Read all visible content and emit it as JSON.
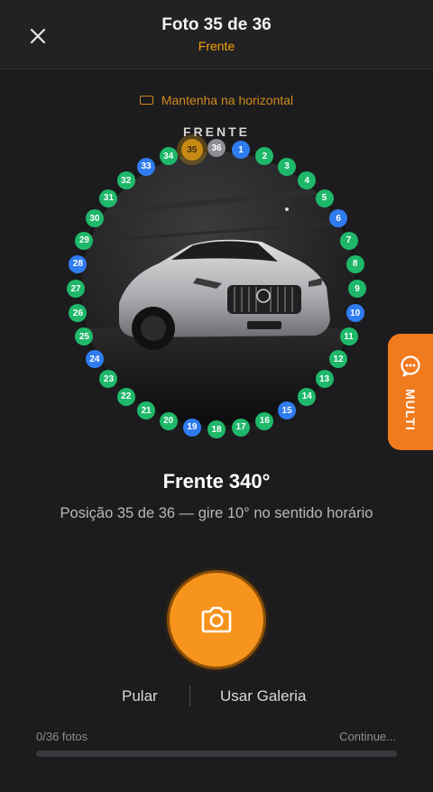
{
  "header": {
    "title": "Foto 35 de 36",
    "subtitle": "Frente"
  },
  "hint": {
    "text": "Mantenha na horizontal"
  },
  "view_label": "FRENTE",
  "positions": [
    {
      "label": "1",
      "status": "blue"
    },
    {
      "label": "2",
      "status": "green"
    },
    {
      "label": "3",
      "status": "green"
    },
    {
      "label": "4",
      "status": "green"
    },
    {
      "label": "5",
      "status": "green"
    },
    {
      "label": "6",
      "status": "blue"
    },
    {
      "label": "7",
      "status": "green"
    },
    {
      "label": "8",
      "status": "green"
    },
    {
      "label": "9",
      "status": "green"
    },
    {
      "label": "10",
      "status": "blue"
    },
    {
      "label": "11",
      "status": "green"
    },
    {
      "label": "12",
      "status": "green"
    },
    {
      "label": "13",
      "status": "green"
    },
    {
      "label": "14",
      "status": "green"
    },
    {
      "label": "15",
      "status": "blue"
    },
    {
      "label": "16",
      "status": "green"
    },
    {
      "label": "17",
      "status": "green"
    },
    {
      "label": "18",
      "status": "green"
    },
    {
      "label": "19",
      "status": "blue"
    },
    {
      "label": "20",
      "status": "green"
    },
    {
      "label": "21",
      "status": "green"
    },
    {
      "label": "22",
      "status": "green"
    },
    {
      "label": "23",
      "status": "green"
    },
    {
      "label": "24",
      "status": "blue"
    },
    {
      "label": "25",
      "status": "green"
    },
    {
      "label": "26",
      "status": "green"
    },
    {
      "label": "27",
      "status": "green"
    },
    {
      "label": "28",
      "status": "blue"
    },
    {
      "label": "29",
      "status": "green"
    },
    {
      "label": "30",
      "status": "green"
    },
    {
      "label": "31",
      "status": "green"
    },
    {
      "label": "32",
      "status": "green"
    },
    {
      "label": "33",
      "status": "blue"
    },
    {
      "label": "34",
      "status": "green"
    },
    {
      "label": "35",
      "status": "current"
    },
    {
      "label": "36",
      "status": "grey"
    }
  ],
  "multi_button": {
    "label": "MULTI"
  },
  "angle": {
    "title": "Frente 340°",
    "instruction": "Posição 35 de 36 — gire 10° no sentido horário"
  },
  "actions": {
    "skip": "Pular",
    "gallery": "Usar Galeria"
  },
  "progress": {
    "label": "0/36 fotos",
    "status": "Continue...",
    "fraction": 0
  },
  "colors": {
    "accent": "#f7941d",
    "status_green": "#1fb86a",
    "status_blue": "#2f7cf0",
    "status_grey": "#8e8e93",
    "status_current": "#c78a14",
    "multi": "#f07a1e"
  }
}
